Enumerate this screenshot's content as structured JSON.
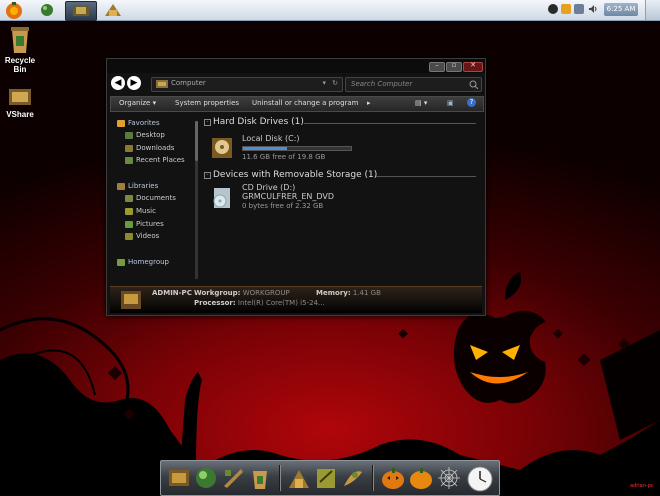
{
  "desktop": {
    "icons": [
      {
        "label": "Recycle Bin"
      },
      {
        "label": "VShare"
      }
    ]
  },
  "tray": {
    "clock": "6:25 AM"
  },
  "explorer": {
    "address": "Computer",
    "search_placeholder": "Search Computer",
    "commands": [
      "Organize",
      "System properties",
      "Uninstall or change a program"
    ],
    "nav": {
      "favorites": {
        "label": "Favorites",
        "items": [
          "Desktop",
          "Downloads",
          "Recent Places"
        ]
      },
      "libraries": {
        "label": "Libraries",
        "items": [
          "Documents",
          "Music",
          "Pictures",
          "Videos"
        ]
      },
      "homegroup": {
        "label": "Homegroup"
      }
    },
    "sections": {
      "hard_disk": {
        "title": "Hard Disk Drives (1)",
        "drive": {
          "name": "Local Disk (C:)",
          "free_text": "11.6 GB free of 19.8 GB",
          "used_fraction": 0.41
        }
      },
      "removable": {
        "title": "Devices with Removable Storage (1)",
        "drive": {
          "name": "CD Drive (D:)",
          "volume": "GRMCULFRER_EN_DVD",
          "free_text": "0 bytes free of 2.32 GB"
        }
      }
    },
    "details": {
      "computer_name": "ADMIN-PC",
      "workgroup_label": "Workgroup:",
      "workgroup_value": "WORKGROUP",
      "memory_label": "Memory:",
      "memory_value": "1.41 GB",
      "processor_label": "Processor:",
      "processor_value": "Intel(R) Core(TM) i5-24..."
    }
  },
  "watermark": "adrian-pc",
  "colors": {
    "background_red": "#b0060a",
    "explorer_bg": "#121212",
    "accent_blue": "#4d8fd0"
  }
}
